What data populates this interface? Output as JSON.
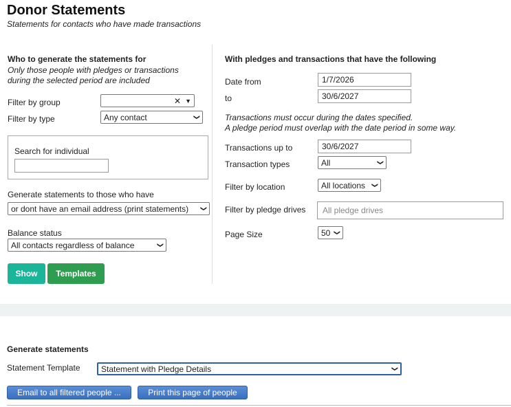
{
  "page": {
    "title": "Donor Statements",
    "subtitle": "Statements for contacts who have made transactions"
  },
  "left": {
    "heading": "Who to generate the statements for",
    "note_line1": "Only those people with pledges or transactions",
    "note_line2": "during the selected period are included",
    "filter_group_label": "Filter by group",
    "filter_group_value": "",
    "filter_type_label": "Filter by type",
    "filter_type_value": "Any contact",
    "search_label": "Search for individual",
    "search_value": "",
    "email_label": "Generate statements to those who have",
    "email_value": "or dont have an email address (print statements)",
    "balance_label": "Balance status",
    "balance_value": "All contacts regardless of balance",
    "show_button": "Show",
    "templates_button": "Templates"
  },
  "right": {
    "heading": "With pledges and transactions that have the following",
    "date_from_label": "Date from",
    "date_from_value": "1/7/2026",
    "to_label": "to",
    "to_value": "30/6/2027",
    "note_line1": "Transactions must occur during the dates specified.",
    "note_line2": "A pledge period must overlap with the date period in some way.",
    "trans_up_to_label": "Transactions up to",
    "trans_up_to_value": "30/6/2027",
    "trans_types_label": "Transaction types",
    "trans_types_value": "All",
    "location_label": "Filter by location",
    "location_value": "All locations",
    "pledge_drives_label": "Filter by pledge drives",
    "pledge_drives_placeholder": "All pledge drives",
    "page_size_label": "Page Size",
    "page_size_value": "50"
  },
  "generate": {
    "heading": "Generate statements",
    "template_label": "Statement Template",
    "template_value": "Statement with Pledge Details",
    "email_button": "Email to all filtered people ...",
    "print_button": "Print this page of people"
  },
  "icons": {
    "clear": "✕",
    "caret": "⏷",
    "chevron": "⌄"
  }
}
